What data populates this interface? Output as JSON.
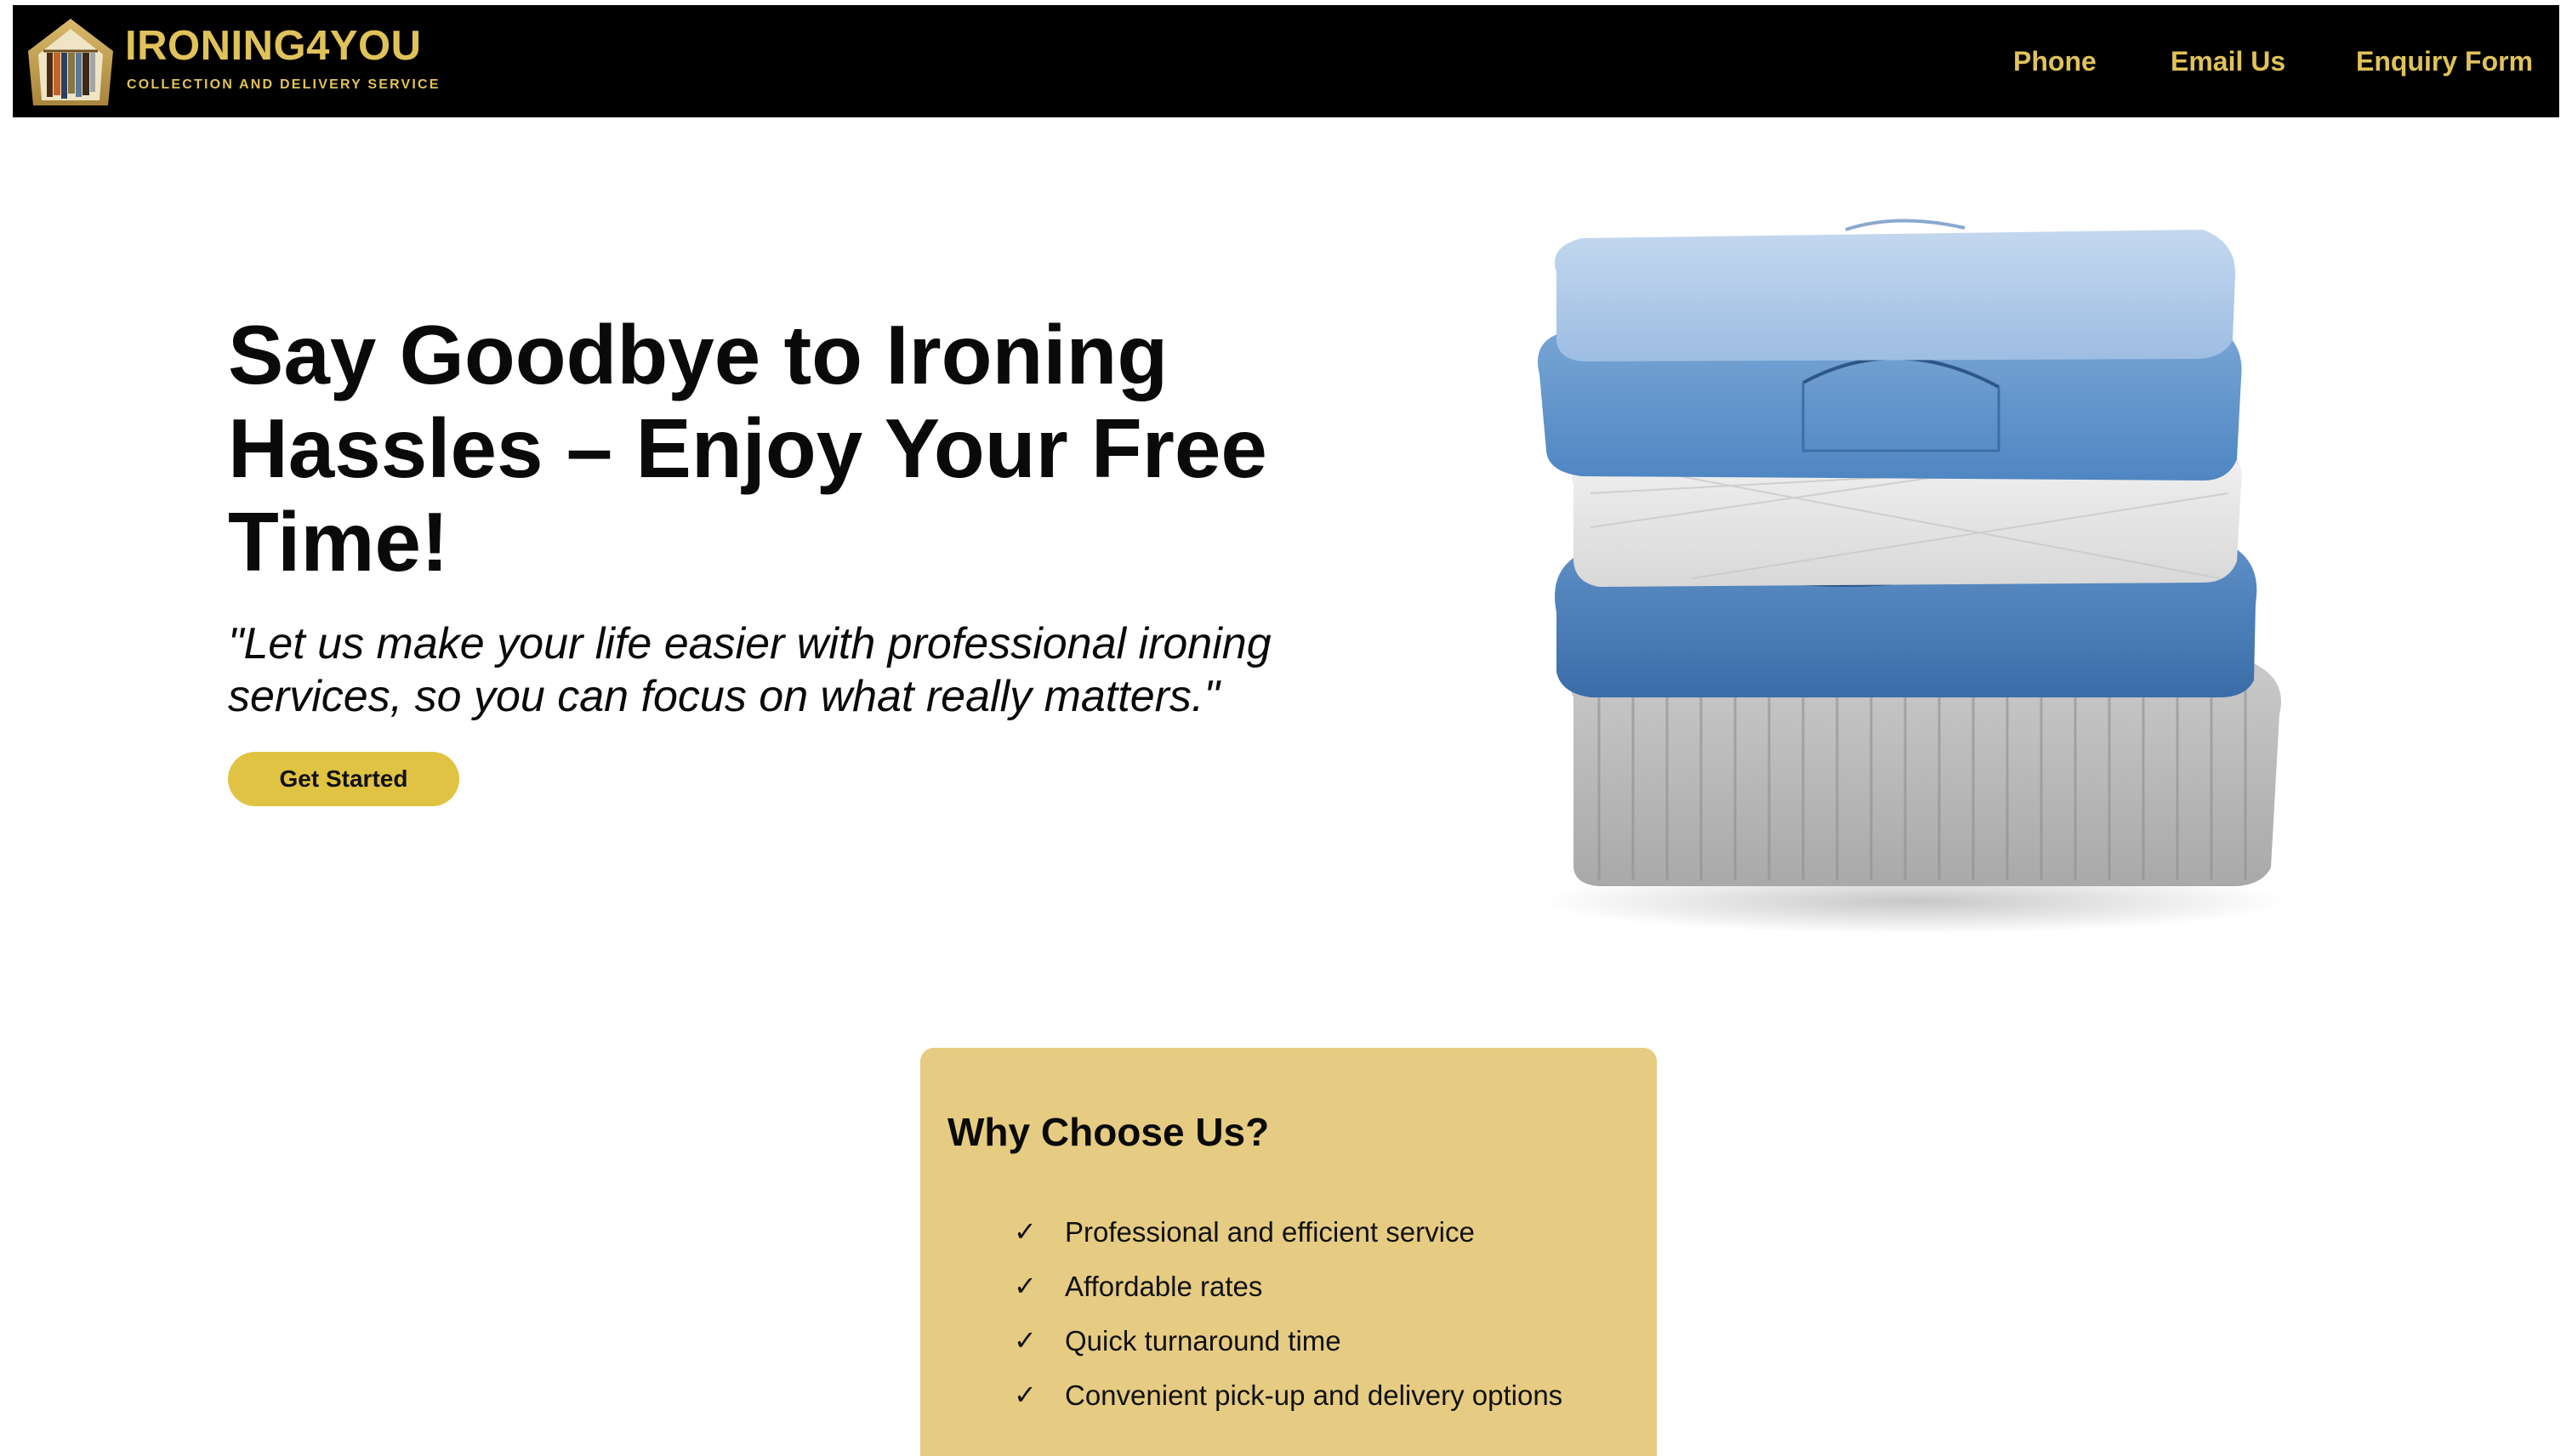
{
  "header": {
    "brand_title": "IRONING4YOU",
    "brand_subtitle": "COLLECTION AND DELIVERY SERVICE",
    "nav": {
      "phone": "Phone",
      "email": "Email Us",
      "enquiry": "Enquiry Form"
    }
  },
  "hero": {
    "heading": "Say Goodbye to Ironing Hassles – Enjoy Your Free Time!",
    "quote": "\"Let us make your life easier with professional ironing services, so you can focus on what really matters.\"",
    "cta_label": "Get Started"
  },
  "why": {
    "title": "Why Choose Us?",
    "items": [
      "Professional and efficient service",
      "Affordable rates",
      "Quick turnaround time",
      "Convenient pick-up and delivery options"
    ],
    "check_glyph": "✓"
  },
  "colors": {
    "header_bg": "#000000",
    "brand_gold": "#e0c25a",
    "cta_yellow": "#e1c344",
    "card_bg": "#e6cb82",
    "text_dark": "#0a0a0a"
  },
  "icons": {
    "logo": "house-with-clothes-rack-logo",
    "check": "check-icon"
  }
}
